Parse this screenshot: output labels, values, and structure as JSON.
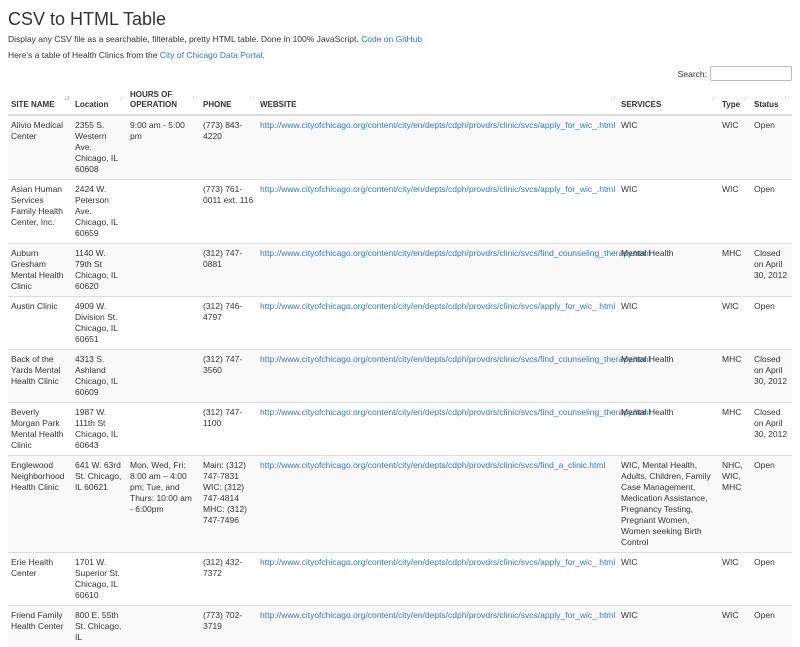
{
  "page": {
    "title": "CSV to HTML Table",
    "description": "Display any CSV file as a searchable, filterable, pretty HTML table. Done in 100% JavaScript.",
    "github_link": "Code on GitHub",
    "intro_prefix": "Here's a table of Health Clinics from the",
    "intro_link": "City of Chicago Data Portal",
    "intro_suffix": "."
  },
  "search": {
    "label": "Search:",
    "value": ""
  },
  "table": {
    "columns": [
      "SITE NAME",
      "Location",
      "HOURS OF OPERATION",
      "PHONE",
      "WEBSITE",
      "SERVICES",
      "Type",
      "Status"
    ],
    "rows": [
      [
        "Alivio Medical Center",
        "2355 S. Western Ave. Chicago, IL 60608",
        "9:00 am - 5:00 pm",
        "(773) 843-4220",
        "http://www.cityofchicago.org/content/city/en/depts/cdph/provdrs/clinic/svcs/apply_for_wic_.html",
        "WIC",
        "WIC",
        "Open"
      ],
      [
        "Asian Human Services Family Health Center, Inc.",
        "2424 W. Peterson Ave. Chicago, IL 60659",
        "",
        "(773) 761-0011 ext. 116",
        "http://www.cityofchicago.org/content/city/en/depts/cdph/provdrs/clinic/svcs/apply_for_wic_.html",
        "WIC",
        "WIC",
        "Open"
      ],
      [
        "Auburn Gresham Mental Health Clinic",
        "1140 W. 79th St Chicago, IL 60620",
        "",
        "(312) 747-0881",
        "http://www.cityofchicago.org/content/city/en/depts/cdph/provdrs/clinic/svcs/find_counseling_therapy.html",
        "Mental Health",
        "MHC",
        "Closed on April 30, 2012"
      ],
      [
        "Austin Clinic",
        "4909 W. Division St. Chicago, IL 60651",
        "",
        "(312) 746-4797",
        "http://www.cityofchicago.org/content/city/en/depts/cdph/provdrs/clinic/svcs/apply_for_wic_.html",
        "WIC",
        "WIC",
        "Open"
      ],
      [
        "Back of the Yards Mental Health Clinic",
        "4313 S. Ashland Chicago, IL 60609",
        "",
        "(312) 747-3560",
        "http://www.cityofchicago.org/content/city/en/depts/cdph/provdrs/clinic/svcs/find_counseling_therapy.html",
        "Mental Health",
        "MHC",
        "Closed on April 30, 2012"
      ],
      [
        "Beverly Morgan Park Mental Health Clinic",
        "1987 W. 111th St Chicago, IL 60643",
        "",
        "(312) 747-1100",
        "http://www.cityofchicago.org/content/city/en/depts/cdph/provdrs/clinic/svcs/find_counseling_therapy.html",
        "Mental Health",
        "MHC",
        "Closed on April 30, 2012"
      ],
      [
        "Englewood Neighborhood Health Clinic",
        "641 W. 63rd St. Chicago, IL 60621",
        "Mon, Wed, Fri: 8:00 am – 4:00 pm; Tue, and Thurs: 10:00 am - 6:00pm",
        "Main: (312) 747-7831 WIC: (312) 747-4814 MHC: (312) 747-7496",
        "http://www.cityofchicago.org/content/city/en/depts/cdph/provdrs/clinic/svcs/find_a_clinic.html",
        "WIC, Mental Health, Adults, Children, Family Case Management, Medication Assistance, Pregnancy Testing, Pregnant Women, Women seeking Birth Control",
        "NHC, WIC, MHC",
        "Open"
      ],
      [
        "Erie Health Center",
        "1701 W. Superior St. Chicago, IL 60610",
        "",
        "(312) 432-7372",
        "http://www.cityofchicago.org/content/city/en/depts/cdph/provdrs/clinic/svcs/apply_for_wic_.html",
        "WIC",
        "WIC",
        "Open"
      ],
      [
        "Friend Family Health Center",
        "800 E. 55th St. Chicago, IL",
        "",
        "(773) 702-3719",
        "http://www.cityofchicago.org/content/city/en/depts/cdph/provdrs/clinic/svcs/apply_for_wic_.html",
        "WIC",
        "WIC",
        "Open"
      ]
    ]
  },
  "colors": {
    "link": "#337ab7",
    "stripe": "#f9f9f9",
    "border": "#dddddd"
  }
}
